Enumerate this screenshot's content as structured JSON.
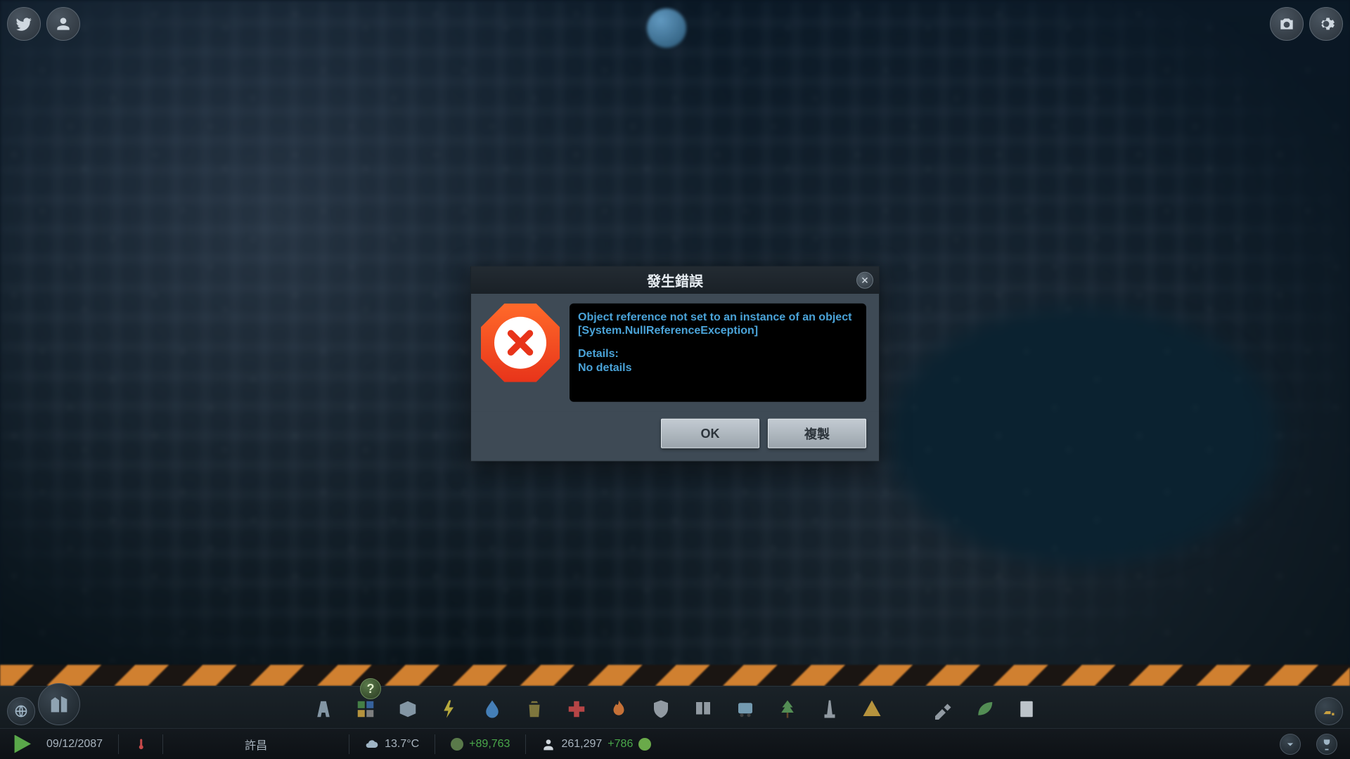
{
  "dialog": {
    "title": "發生錯誤",
    "error_line1": "Object reference not set to an instance of an object",
    "error_line2": "[System.NullReferenceException]",
    "details_label": "Details:",
    "details_body": "No details",
    "ok_label": "OK",
    "copy_label": "複製"
  },
  "status": {
    "date": "09/12/2087",
    "city_name": "許昌",
    "temperature": "13.7°C",
    "population": "261,297",
    "money_delta": "+89,763",
    "pop_delta": "+786"
  },
  "help_symbol": "?"
}
